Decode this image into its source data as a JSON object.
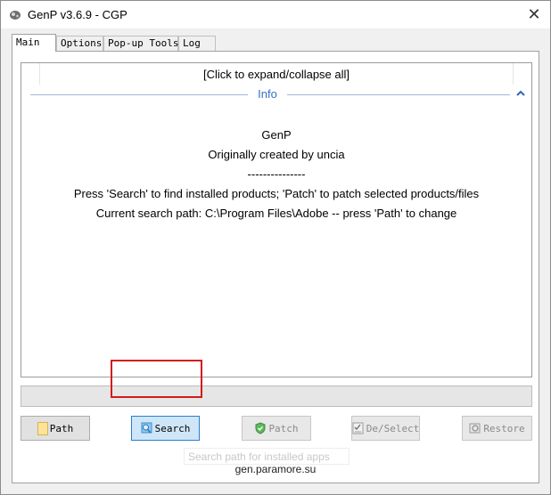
{
  "window": {
    "title": "GenP v3.6.9 - CGP",
    "close_glyph": "✕"
  },
  "tabs": [
    {
      "label": "Main",
      "active": true
    },
    {
      "label": "Options",
      "active": false
    },
    {
      "label": "Pop-up Tools",
      "active": false
    },
    {
      "label": "Log",
      "active": false
    }
  ],
  "info": {
    "expand_collapse": "[Click to expand/collapse all]",
    "section_title": "Info",
    "lines": [
      "GenP",
      "Originally created by uncia",
      "---------------",
      "Press 'Search' to find installed products; 'Patch' to patch selected products/files",
      "Current search path: C:\\Program Files\\Adobe -- press 'Path' to change"
    ]
  },
  "buttons": {
    "path": "Path",
    "search": "Search",
    "patch": "Patch",
    "deselect": "De/Select",
    "restore": "Restore"
  },
  "tooltip": "Search path for installed apps",
  "footer": "gen.paramore.su",
  "colors": {
    "accent": "#3470c4",
    "highlight": "#d21a1a"
  }
}
